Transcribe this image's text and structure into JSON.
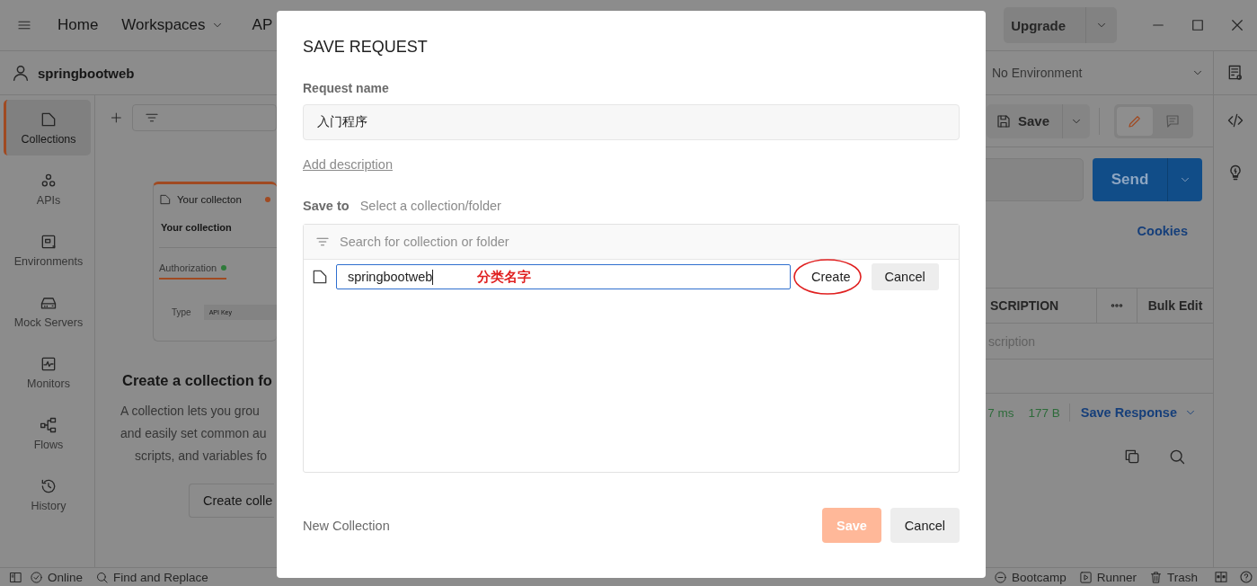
{
  "header": {
    "nav": [
      {
        "label": "Home",
        "dropdown": false
      },
      {
        "label": "Workspaces",
        "dropdown": true
      },
      {
        "label": "AP",
        "dropdown": false
      }
    ],
    "upgrade": "Upgrade"
  },
  "workspace": {
    "name": "springbootweb",
    "environment": "No Environment"
  },
  "sidebar": {
    "items": [
      {
        "label": "Collections",
        "selected": true
      },
      {
        "label": "APIs",
        "selected": false
      },
      {
        "label": "Environments",
        "selected": false
      },
      {
        "label": "Mock Servers",
        "selected": false
      },
      {
        "label": "Monitors",
        "selected": false
      },
      {
        "label": "Flows",
        "selected": false
      },
      {
        "label": "History",
        "selected": false
      }
    ]
  },
  "collections_panel": {
    "preview": {
      "tab_title": "Your collecton",
      "title": "Your collection",
      "tab": "Authorization",
      "type_label": "Type",
      "type_value": "API Key"
    },
    "heading": "Create a collection fo",
    "lines": [
      "A collection lets you grou",
      "and easily set common au",
      "scripts, and variables fo"
    ],
    "button": "Create colle"
  },
  "request": {
    "save": "Save",
    "modes": [
      {
        "selected": true
      },
      {
        "selected": false
      }
    ],
    "send": "Send",
    "cookies": "Cookies",
    "table": {
      "columns": [
        "SCRIPTION",
        "Bulk Edit"
      ],
      "placeholder": "scription"
    },
    "response": {
      "time": "7 ms",
      "size": "177 B",
      "save_response": "Save Response"
    }
  },
  "status_bar": {
    "left": [
      "Online",
      "Find and Replace"
    ],
    "right": [
      "Bootcamp",
      "Runner",
      "Trash"
    ]
  },
  "dialog": {
    "title": "SAVE REQUEST",
    "name_label": "Request name",
    "name_value": "入门程序",
    "add_description": "Add description",
    "save_to_label": "Save to",
    "save_to_hint": "Select a collection/folder",
    "search_placeholder": "Search for collection or folder",
    "new_collection": {
      "value": "springbootweb",
      "annotation": "分类名字",
      "create": "Create",
      "cancel": "Cancel",
      "highlighted": true
    },
    "footer_link": "New Collection",
    "save": {
      "label": "Save",
      "disabled": true
    },
    "cancel": "Cancel"
  }
}
